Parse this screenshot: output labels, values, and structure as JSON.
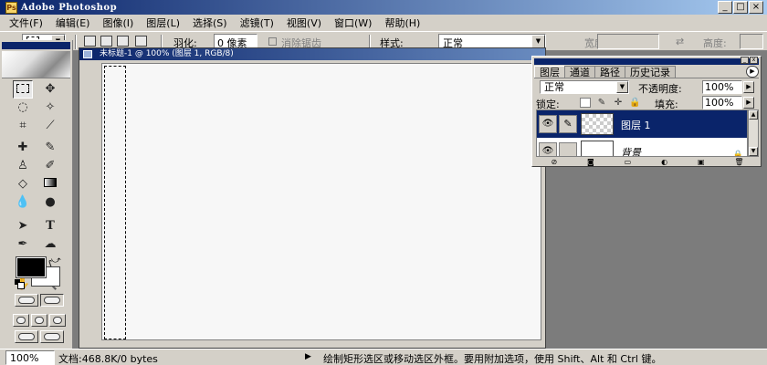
{
  "window": {
    "title": "Adobe Photoshop",
    "min": "_",
    "max": "□",
    "close": "×"
  },
  "menu": [
    "文件(F)",
    "编辑(E)",
    "图像(I)",
    "图层(L)",
    "选择(S)",
    "滤镜(T)",
    "视图(V)",
    "窗口(W)",
    "帮助(H)"
  ],
  "options": {
    "feather_label": "羽化:",
    "feather_value": "0 像素",
    "antialias_label": "消除锯齿",
    "style_label": "样式:",
    "style_value": "正常",
    "width_label": "宽度:",
    "height_label": "高度:"
  },
  "document": {
    "title": "未标题-1 @ 100% (图层 1, RGB/8)"
  },
  "layers_panel": {
    "tabs": [
      "图层",
      "通道",
      "路径",
      "历史记录"
    ],
    "blend_mode": "正常",
    "opacity_label": "不透明度:",
    "opacity_value": "100%",
    "lock_label": "锁定:",
    "fill_label": "填充:",
    "fill_value": "100%",
    "layers": [
      {
        "name": "图层 1",
        "selected": true
      },
      {
        "name": "背景",
        "selected": false,
        "locked": true
      }
    ]
  },
  "status": {
    "zoom": "100%",
    "doc_info": "文档:468.8K/0 bytes",
    "hint": "绘制矩形选区或移动选区外框。要用附加选项，使用 Shift、Alt 和 Ctrl 键。"
  },
  "colors": {
    "titlebar": "#0a246a",
    "chrome": "#d4d0c8",
    "workspace": "#7c7c7c",
    "foreground": "#000000",
    "background": "#ffffff"
  }
}
